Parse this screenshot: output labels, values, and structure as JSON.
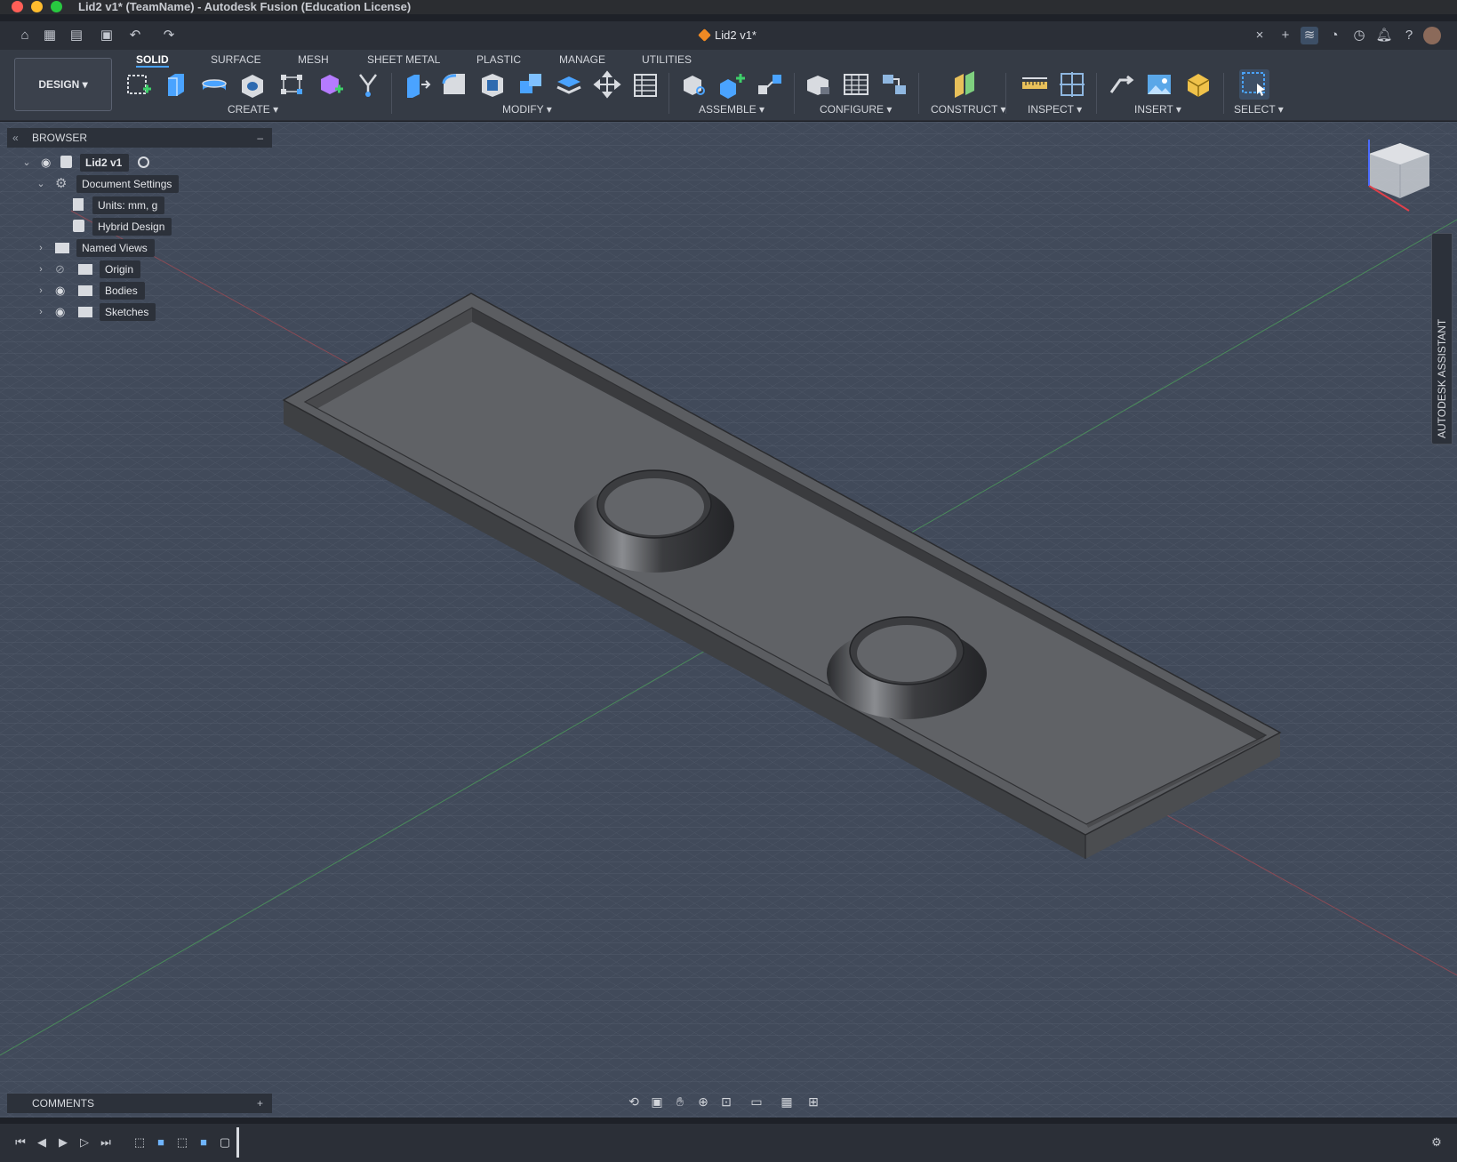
{
  "window": {
    "title": "Lid2 v1* (TeamName) - Autodesk Fusion (Education License)"
  },
  "document_tab": {
    "label": "Lid2 v1*"
  },
  "workspace": {
    "label": "DESIGN"
  },
  "ribbon_tabs": [
    {
      "label": "SOLID",
      "active": true
    },
    {
      "label": "SURFACE"
    },
    {
      "label": "MESH"
    },
    {
      "label": "SHEET METAL"
    },
    {
      "label": "PLASTIC"
    },
    {
      "label": "MANAGE"
    },
    {
      "label": "UTILITIES"
    }
  ],
  "ribbon_groups": [
    {
      "label": "CREATE"
    },
    {
      "label": "MODIFY"
    },
    {
      "label": "ASSEMBLE"
    },
    {
      "label": "CONFIGURE"
    },
    {
      "label": "CONSTRUCT"
    },
    {
      "label": "INSPECT"
    },
    {
      "label": "INSERT"
    },
    {
      "label": "SELECT"
    }
  ],
  "browser": {
    "title": "BROWSER",
    "items": [
      {
        "label": "Lid2 v1"
      },
      {
        "label": "Document Settings"
      },
      {
        "label": "Units: mm, g"
      },
      {
        "label": "Hybrid Design"
      },
      {
        "label": "Named Views"
      },
      {
        "label": "Origin"
      },
      {
        "label": "Bodies"
      },
      {
        "label": "Sketches"
      }
    ]
  },
  "assistant": {
    "label": "AUTODESK ASSISTANT"
  },
  "comments": {
    "label": "COMMENTS"
  },
  "colors": {
    "viewport_bg": "#414a5a",
    "grid_line": "#5a6373",
    "body": "#5f6165",
    "accent": "#4aa3ff"
  }
}
